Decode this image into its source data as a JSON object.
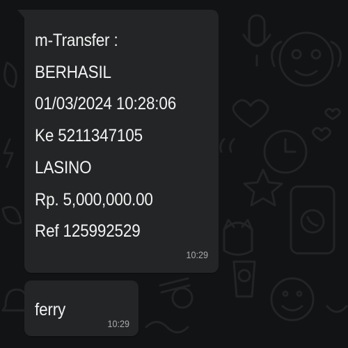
{
  "chat": {
    "theme": {
      "background": "#121314",
      "bubble": "#242526",
      "text": "#f2f2f2",
      "time": "#a9acad"
    },
    "messages": [
      {
        "lines": [
          "m-Transfer :",
          "BERHASIL",
          "01/03/2024 10:28:06",
          "Ke 5211347105",
          "LASINO",
          "Rp. 5,000,000.00",
          "Ref 125992529"
        ],
        "time": "10:29"
      },
      {
        "lines": [
          "ferry"
        ],
        "time": "10:29"
      }
    ]
  }
}
